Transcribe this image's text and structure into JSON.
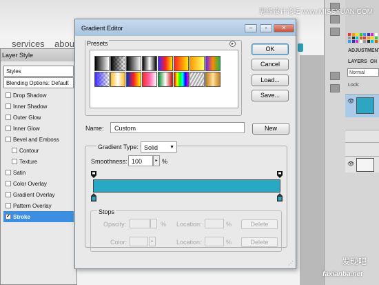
{
  "background_page": {
    "nav_items": [
      "services",
      "about"
    ]
  },
  "layer_style": {
    "title": "Layer Style",
    "items": [
      {
        "label": "Styles",
        "boxed": true,
        "checkbox": false
      },
      {
        "label": "Blending Options: Default",
        "boxed": true,
        "checkbox": false
      },
      {
        "label": "Drop Shadow",
        "checkbox": true,
        "checked": false
      },
      {
        "label": "Inner Shadow",
        "checkbox": true,
        "checked": false
      },
      {
        "label": "Outer Glow",
        "checkbox": true,
        "checked": false
      },
      {
        "label": "Inner Glow",
        "checkbox": true,
        "checked": false
      },
      {
        "label": "Bevel and Emboss",
        "checkbox": true,
        "checked": false
      },
      {
        "label": "Contour",
        "checkbox": true,
        "checked": false,
        "indent": true
      },
      {
        "label": "Texture",
        "checkbox": true,
        "checked": false,
        "indent": true
      },
      {
        "label": "Satin",
        "checkbox": true,
        "checked": false
      },
      {
        "label": "Color Overlay",
        "checkbox": true,
        "checked": false
      },
      {
        "label": "Gradient Overlay",
        "checkbox": true,
        "checked": false
      },
      {
        "label": "Pattern Overlay",
        "checkbox": true,
        "checked": false
      },
      {
        "label": "Stroke",
        "checkbox": true,
        "checked": true,
        "selected": true
      }
    ]
  },
  "gradient_editor": {
    "title": "Gradient Editor",
    "presets_label": "Presets",
    "buttons": {
      "ok": "OK",
      "cancel": "Cancel",
      "load": "Load...",
      "save": "Save...",
      "new": "New"
    },
    "name_label": "Name:",
    "name_value": "Custom",
    "gradient_type_label": "Gradient Type:",
    "gradient_type_value": "Solid",
    "smoothness_label": "Smoothness:",
    "smoothness_value": "100",
    "smoothness_unit": "%",
    "gradient_color": "#27a9c4",
    "stops": {
      "label": "Stops",
      "opacity_label": "Opacity:",
      "color_label": "Color:",
      "location_label": "Location:",
      "percent": "%",
      "delete_label": "Delete"
    }
  },
  "photoshop_panels": {
    "adjustments_tab": "ADJUSTMENT",
    "layers_tab": "LAYERS",
    "channels_tab": "CH",
    "blend_mode": "Normal",
    "lock_label": "Lock:"
  },
  "watermarks": {
    "top": "思缘设计论坛 www.MISSYUAN.COM",
    "brand": "发现吧",
    "url": "faxianba.net"
  }
}
